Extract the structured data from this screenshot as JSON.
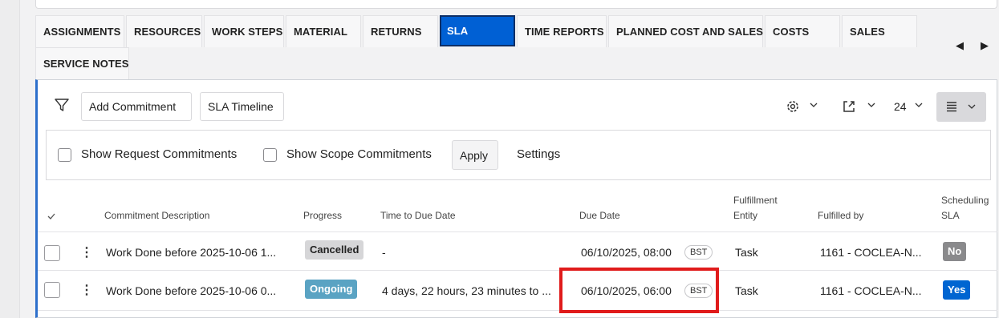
{
  "tabs": [
    {
      "label": "ASSIGNMENTS"
    },
    {
      "label": "RESOURCES"
    },
    {
      "label": "WORK STEPS"
    },
    {
      "label": "MATERIAL"
    },
    {
      "label": "RETURNS"
    },
    {
      "label": "SLA"
    },
    {
      "label": "TIME REPORTS"
    },
    {
      "label": "PLANNED COST AND SALES"
    },
    {
      "label": "COSTS"
    },
    {
      "label": "SALES"
    },
    {
      "label": "SERVICE NOTES"
    }
  ],
  "active_tab": "SLA",
  "toolbar": {
    "add_commitment": "Add Commitment",
    "sla_timeline": "SLA Timeline",
    "page_size": "24"
  },
  "filters": {
    "show_request": "Show Request Commitments",
    "show_scope": "Show Scope Commitments",
    "apply": "Apply",
    "settings": "Settings"
  },
  "columns": {
    "description": "Commitment Description",
    "progress": "Progress",
    "time_to_due": "Time to Due Date",
    "due_date": "Due Date",
    "fulfillment_entity_1": "Fulfillment",
    "fulfillment_entity_2": "Entity",
    "fulfilled_by": "Fulfilled by",
    "scheduling_sla_1": "Scheduling",
    "scheduling_sla_2": "SLA"
  },
  "rows": [
    {
      "description": "Work Done before 2025-10-06 1...",
      "progress": "Cancelled",
      "time_to_due": "-",
      "due_date": "06/10/2025, 08:00",
      "tz": "BST",
      "entity": "Task",
      "fulfilled_by": "1161 - COCLEA-N...",
      "scheduling": "No"
    },
    {
      "description": "Work Done before 2025-10-06 0...",
      "progress": "Ongoing",
      "time_to_due": "4 days, 22 hours, 23 minutes to ...",
      "due_date": "06/10/2025, 06:00",
      "tz": "BST",
      "entity": "Task",
      "fulfilled_by": "1161 - COCLEA-N...",
      "scheduling": "Yes"
    }
  ],
  "colors": {
    "active_tab": "#0060d4",
    "cancelled": "#d6d6d8",
    "ongoing": "#5aa3c3",
    "no_badge": "#8a8a8c",
    "yes_badge": "#0065d1",
    "highlight": "#e01b1b"
  },
  "icons": [
    "filter-icon",
    "gear-icon",
    "export-icon",
    "chevron-down-icon",
    "list-view-icon",
    "chevron-left-icon",
    "chevron-right-icon",
    "kebab-icon",
    "checkmark-icon"
  ]
}
